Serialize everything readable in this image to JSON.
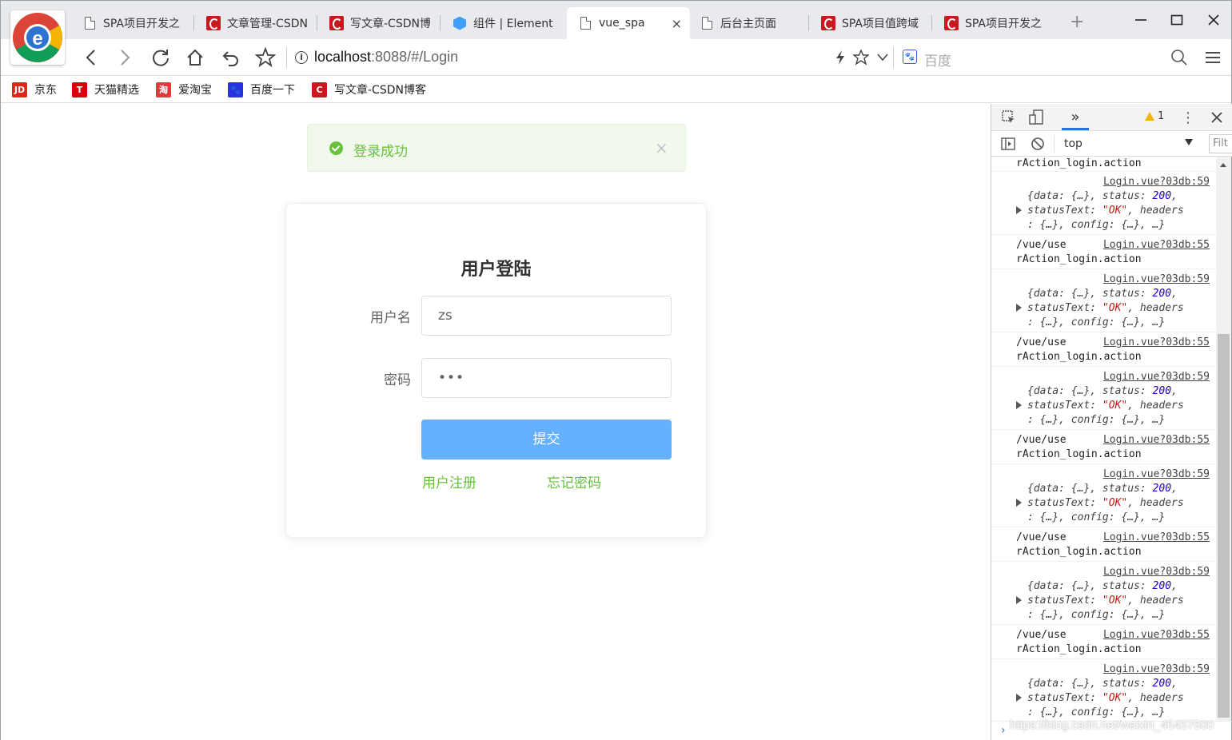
{
  "browser": {
    "tabs": [
      {
        "title": "SPA项目开发之",
        "icon": "page-icon"
      },
      {
        "title": "文章管理-CSDN",
        "icon": "csdn-icon"
      },
      {
        "title": "写文章-CSDN博",
        "icon": "csdn-icon"
      },
      {
        "title": "组件 | Element",
        "icon": "element-icon"
      },
      {
        "title": "vue_spa",
        "icon": "page-icon",
        "active": true
      },
      {
        "title": "后台主页面",
        "icon": "page-icon"
      },
      {
        "title": "SPA项目值跨域",
        "icon": "csdn-icon"
      },
      {
        "title": "SPA项目开发之",
        "icon": "csdn-icon"
      }
    ],
    "address": {
      "host": "localhost",
      "rest": ":8088/#/Login"
    },
    "search_placeholder": "百度",
    "bookmarks": [
      {
        "label": "京东",
        "icon": "jd-icon",
        "badge": "JD",
        "color": "#e1251b"
      },
      {
        "label": "天猫精选",
        "icon": "tmall-icon",
        "badge": "T",
        "color": "#d7000f"
      },
      {
        "label": "爱淘宝",
        "icon": "taobao-icon",
        "badge": "淘",
        "color": "#e4393c"
      },
      {
        "label": "百度一下",
        "icon": "baidu-paw-icon",
        "badge": "🐾",
        "color": "#2932e1"
      },
      {
        "label": "写文章-CSDN博客",
        "icon": "csdn-icon",
        "badge": "C",
        "color": "#c9181f"
      }
    ]
  },
  "page": {
    "toast": {
      "message": "登录成功",
      "close": "×"
    },
    "login": {
      "title": "用户登陆",
      "username_label": "用户名",
      "username_value": "zs",
      "password_label": "密码",
      "password_value": "•••",
      "submit_label": "提交",
      "register_link": "用户注册",
      "forgot_link": "忘记密码"
    }
  },
  "devtools": {
    "warning_count": "1",
    "context": "top",
    "filter_placeholder": "Filt",
    "console_first_line": "rAction_login.action",
    "logs": [
      {
        "kind": "obj",
        "src": "Login.vue?03db:59"
      },
      {
        "kind": "path",
        "src": "Login.vue?03db:55"
      },
      {
        "kind": "obj",
        "src": "Login.vue?03db:59"
      },
      {
        "kind": "path",
        "src": "Login.vue?03db:55"
      },
      {
        "kind": "obj",
        "src": "Login.vue?03db:59"
      },
      {
        "kind": "path",
        "src": "Login.vue?03db:55"
      },
      {
        "kind": "obj",
        "src": "Login.vue?03db:59"
      },
      {
        "kind": "path",
        "src": "Login.vue?03db:55"
      },
      {
        "kind": "obj",
        "src": "Login.vue?03db:59"
      },
      {
        "kind": "path",
        "src": "Login.vue?03db:55"
      },
      {
        "kind": "obj",
        "src": "Login.vue?03db:59"
      }
    ],
    "obj_text": {
      "l1a": "{data: {…}, status: ",
      "status": "200",
      "l1b": ",",
      "l2a": "statusText: ",
      "statusText": "\"OK\"",
      "l2b": ", headers",
      "l3": ": {…}, config: {…}, …}"
    },
    "path_text": {
      "prefix": "/vue/use",
      "action": "rAction_login.action"
    }
  },
  "watermark": "https://blog.csdn.net/weixin_45457500"
}
